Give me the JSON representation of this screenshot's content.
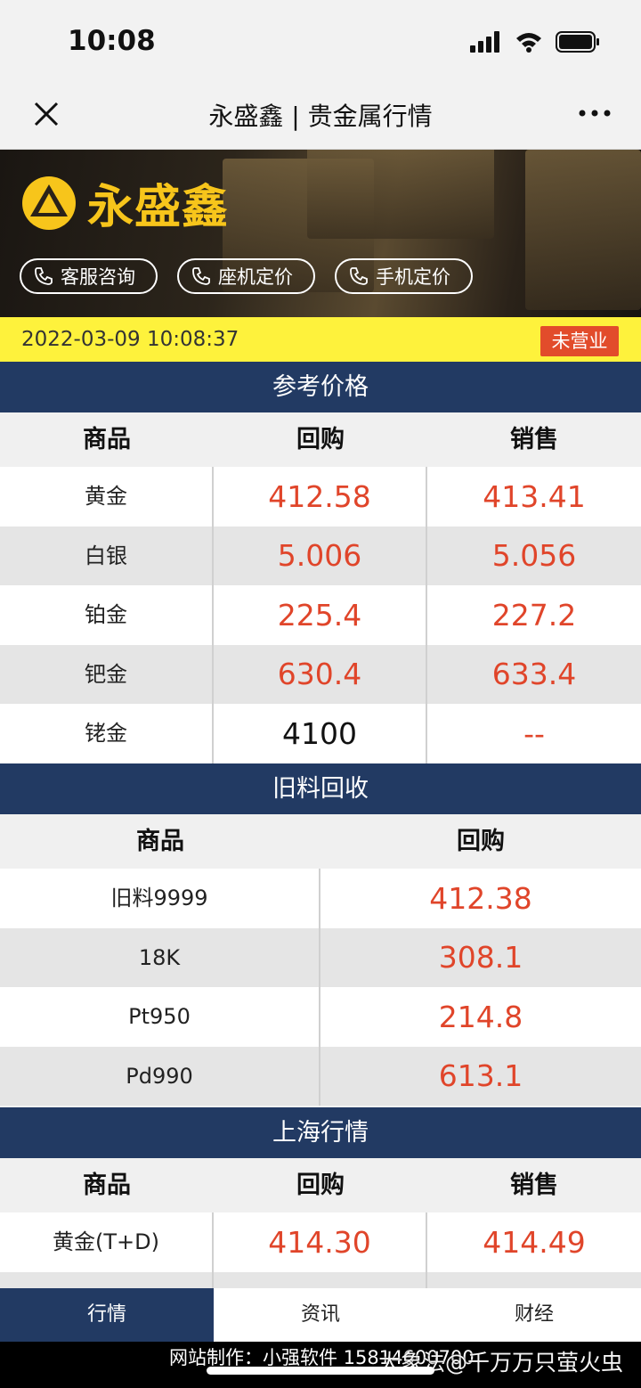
{
  "status": {
    "time": "10:08"
  },
  "nav": {
    "title": "永盛鑫 | 贵金属行情",
    "close_icon": "close-icon",
    "more_icon": "more-icon"
  },
  "banner": {
    "logo_text": "永盛鑫",
    "logo_color": "#f7c51b",
    "buttons": [
      "客服咨询",
      "座机定价",
      "手机定价"
    ]
  },
  "datebar": {
    "datetime": "2022-03-09 10:08:37",
    "status_badge": "未营业",
    "bg": "#fef23c",
    "badge_color": "#e24c2b"
  },
  "reference": {
    "title": "参考价格",
    "headers": [
      "商品",
      "回购",
      "销售"
    ],
    "rows": [
      {
        "name": "黄金",
        "buy": "412.58",
        "sell": "413.41"
      },
      {
        "name": "白银",
        "buy": "5.006",
        "sell": "5.056"
      },
      {
        "name": "铂金",
        "buy": "225.4",
        "sell": "227.2"
      },
      {
        "name": "钯金",
        "buy": "630.4",
        "sell": "633.4"
      },
      {
        "name": "铑金",
        "buy": "4100",
        "sell": "--"
      }
    ]
  },
  "recycle": {
    "title": "旧料回收",
    "headers": [
      "商品",
      "回购"
    ],
    "rows": [
      {
        "name": "旧料9999",
        "buy": "412.38"
      },
      {
        "name": "18K",
        "buy": "308.1"
      },
      {
        "name": "Pt950",
        "buy": "214.8"
      },
      {
        "name": "Pd990",
        "buy": "613.1"
      }
    ]
  },
  "shanghai": {
    "title": "上海行情",
    "headers": [
      "商品",
      "回购",
      "销售"
    ],
    "rows": [
      {
        "name": "黄金(T+D)",
        "buy": "414.30",
        "sell": "414.49"
      }
    ]
  },
  "tabs": [
    "行情",
    "资讯",
    "财经"
  ],
  "footer": {
    "text": "网站制作：小强软件 15814600700",
    "watermark": "大象法@千万万只萤火虫"
  },
  "colors": {
    "header_navy": "#223a63",
    "price_red": "#e0452a"
  }
}
